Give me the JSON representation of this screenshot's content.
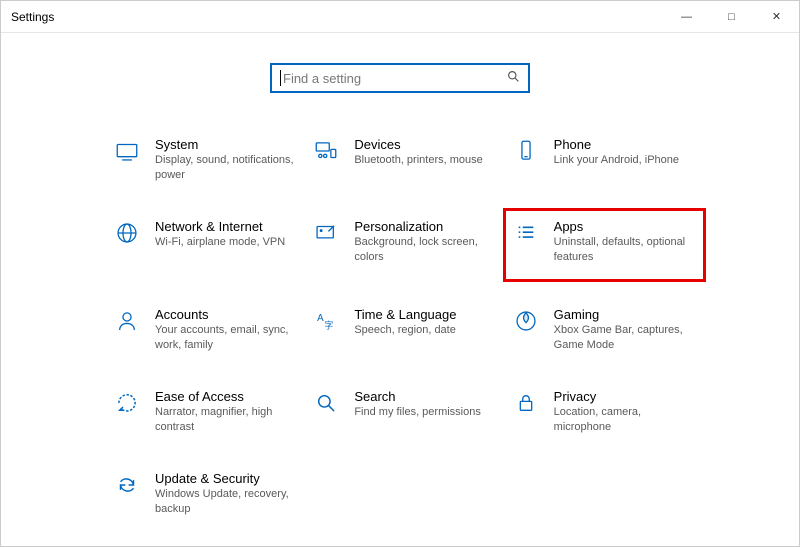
{
  "window": {
    "title": "Settings"
  },
  "colors": {
    "accent": "#0067c0",
    "highlight": "#e60000"
  },
  "search": {
    "placeholder": "Find a setting"
  },
  "tiles": {
    "system": {
      "title": "System",
      "desc": "Display, sound, notifications, power"
    },
    "devices": {
      "title": "Devices",
      "desc": "Bluetooth, printers, mouse"
    },
    "phone": {
      "title": "Phone",
      "desc": "Link your Android, iPhone"
    },
    "network": {
      "title": "Network & Internet",
      "desc": "Wi-Fi, airplane mode, VPN"
    },
    "personalization": {
      "title": "Personalization",
      "desc": "Background, lock screen, colors"
    },
    "apps": {
      "title": "Apps",
      "desc": "Uninstall, defaults, optional features"
    },
    "accounts": {
      "title": "Accounts",
      "desc": "Your accounts, email, sync, work, family"
    },
    "time": {
      "title": "Time & Language",
      "desc": "Speech, region, date"
    },
    "gaming": {
      "title": "Gaming",
      "desc": "Xbox Game Bar, captures, Game Mode"
    },
    "ease": {
      "title": "Ease of Access",
      "desc": "Narrator, magnifier, high contrast"
    },
    "search_tile": {
      "title": "Search",
      "desc": "Find my files, permissions"
    },
    "privacy": {
      "title": "Privacy",
      "desc": "Location, camera, microphone"
    },
    "update": {
      "title": "Update & Security",
      "desc": "Windows Update, recovery, backup"
    }
  }
}
